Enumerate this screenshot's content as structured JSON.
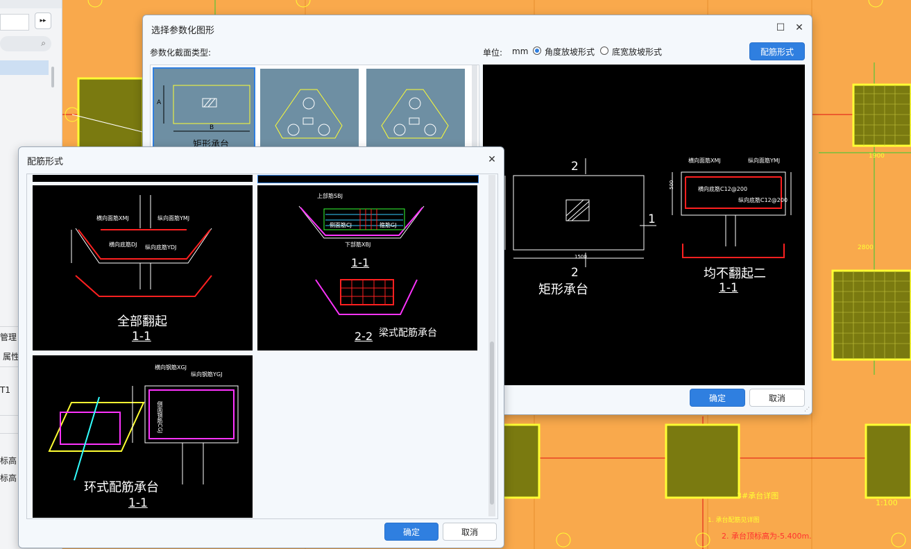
{
  "left_panel": {
    "items": [
      "管理",
      "属性",
      "T1",
      "标高",
      "标高"
    ],
    "expand_label": "▸▸"
  },
  "param_dialog": {
    "title": "选择参数化图形",
    "section_type_label": "参数化截面类型:",
    "unit_label": "单位:",
    "unit_value": "mm",
    "radio_angle": "角度放坡形式",
    "radio_width": "底宽放坡形式",
    "rebar_button": "配筋形式",
    "ok": "确定",
    "cancel": "取消",
    "thumb_1_label": "矩形承台",
    "thumb_dims": {
      "a": "A",
      "b": "B"
    },
    "preview": {
      "section_mark": "2",
      "side_mark": "1",
      "dim_v": "1500",
      "dim_h": "1500",
      "shape_name": "矩形承台",
      "rebar_name": "均不翻起二",
      "section_name": "1-1",
      "label_hmj": "横向面筋XMJ",
      "label_vmj": "纵向面筋YMJ",
      "label_hdj": "横向底筋C12@200",
      "label_vdj": "纵向底筋C12@200",
      "dim_500": "500"
    }
  },
  "rebar_dialog": {
    "title": "配筋形式",
    "ok": "确定",
    "cancel": "取消",
    "cards": [
      {
        "name": "全部翻起",
        "section": "1-1"
      },
      {
        "name": "梁式配筋承台",
        "section_a": "1-1",
        "section_b": "2-2"
      },
      {
        "name": "环式配筋承台",
        "section": "1-1"
      }
    ],
    "labels": {
      "hmj": "横向面筋XMJ",
      "vmj": "纵向面筋YMJ",
      "hdj": "横向底筋DJ",
      "vdj": "纵向底筋YDJ",
      "top_bar": "上部筋SBJ",
      "bottom_bar": "下部筋XBJ",
      "side_bar": "侧面筋CJ",
      "stirrup": "箍筋GJ",
      "h_steel": "横向钢筋XGJ",
      "v_steel": "纵向钢筋YGJ",
      "side_steel": "侧面钢筋CGJ"
    }
  },
  "cad_bg": {
    "dim_1900": "1900",
    "dim_2800": "2800",
    "note_title": "3#承台详图",
    "scale": "1:100",
    "note_1": "1. 承台配筋见详图",
    "note_2": "2. 承台顶标高为-5.400m."
  }
}
